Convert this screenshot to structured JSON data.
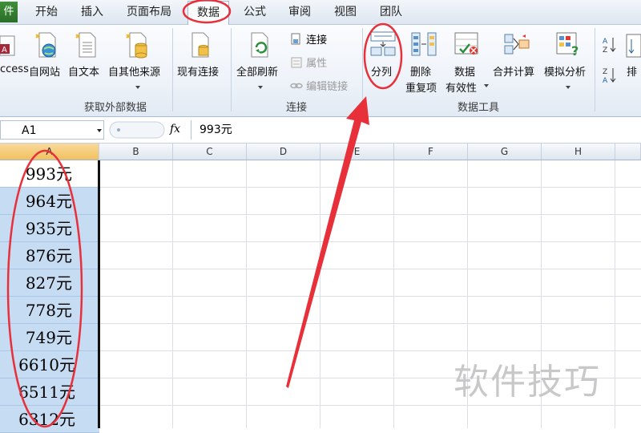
{
  "menu": {
    "file_label": "件",
    "tabs": [
      "开始",
      "插入",
      "页面布局",
      "数据",
      "公式",
      "审阅",
      "视图",
      "团队"
    ],
    "active_tab": "数据"
  },
  "ribbon": {
    "get_external_data": {
      "label": "获取外部数据",
      "access": "ccess",
      "web": "自网站",
      "text": "自文本",
      "other": "自其他来源",
      "existing": "现有连接"
    },
    "connections": {
      "label": "连接",
      "refresh_all": "全部刷新",
      "connections": "连接",
      "properties": "属性",
      "edit_links": "编辑链接"
    },
    "data_tools": {
      "label": "数据工具",
      "text_to_columns": "分列",
      "remove_dup_1": "删除",
      "remove_dup_2": "重复项",
      "validation_1": "数据",
      "validation_2": "有效性",
      "consolidate": "合并计算",
      "what_if": "模拟分析"
    },
    "sort": {
      "sort_label": "排"
    }
  },
  "formula_bar": {
    "name_box": "A1",
    "fx": "fx",
    "content": "993元"
  },
  "columns": [
    "A",
    "B",
    "C",
    "D",
    "E",
    "F",
    "G",
    "H"
  ],
  "cells_A": [
    "993元",
    "964元",
    "935元",
    "876元",
    "827元",
    "778元",
    "749元",
    "6610元",
    "6511元",
    "6312元"
  ],
  "watermark": "软件技巧",
  "colors": {
    "annotation": "#e8303a",
    "selection": "#c5dcf3",
    "file_tab": "#2f7a2b"
  }
}
